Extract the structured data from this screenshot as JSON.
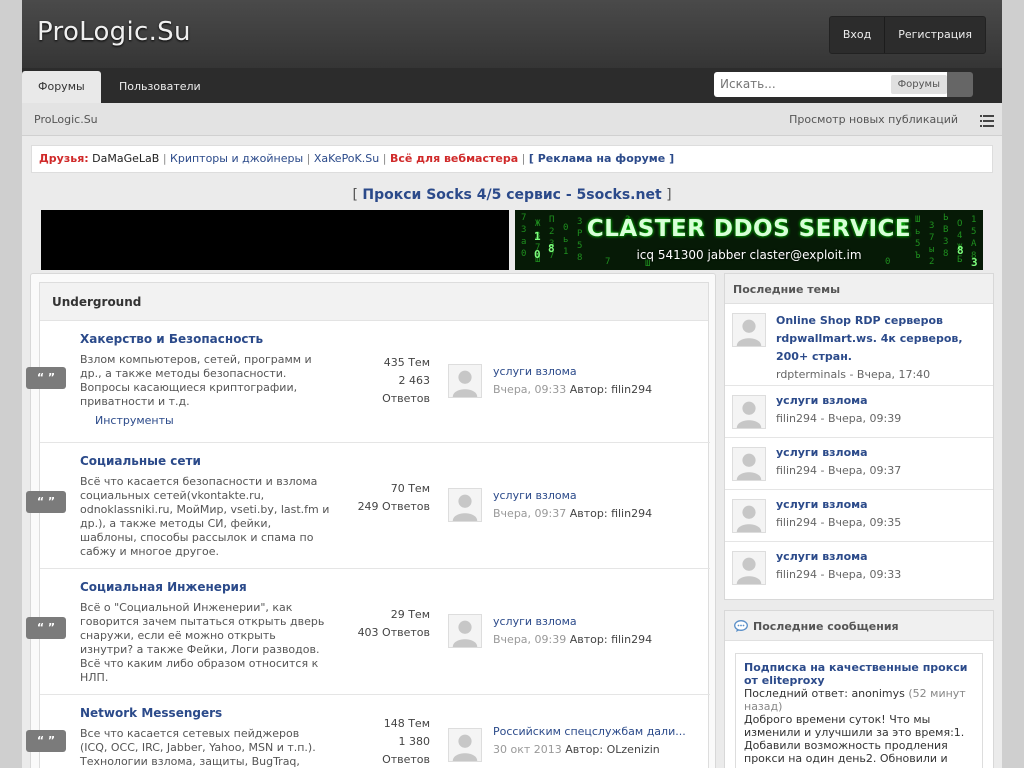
{
  "site": {
    "logo": "ProLogic.Su"
  },
  "userbar": {
    "login": "Вход",
    "register": "Регистрация"
  },
  "nav": {
    "tabs": [
      {
        "label": "Форумы"
      },
      {
        "label": "Пользователи"
      }
    ],
    "search_placeholder": "Искать...",
    "search_scope": "Форумы"
  },
  "breadcrumb": {
    "home": "ProLogic.Su",
    "new_posts": "Просмотр новых публикаций"
  },
  "friends": {
    "label": "Друзья:",
    "links": [
      "DaMaGeLaB",
      "Крипторы и джойнеры",
      "XaKePoK.Su",
      "Всё для вебмастера",
      "[ Реклама на форуме ]"
    ],
    "separator": "|"
  },
  "proxy_ad": {
    "open": "[",
    "link": "Прокси Socks 4/5 сервис - 5socks.net",
    "close": "]"
  },
  "banner": {
    "title": "CLASTER DDOS SERVICE",
    "contacts": "icq 541300    jabber claster@exploit.im"
  },
  "category": {
    "title": "Underground",
    "quote_tag": "“ ”",
    "forums": [
      {
        "title": "Хакерство и Безопасность",
        "desc": "Взлом компьютеров, сетей, программ и др., а также методы безопасности. Вопросы касающиеся криптографии, приватности и т.д.",
        "subforum": "Инструменты",
        "stats": [
          "435 Тем",
          "2 463",
          "Ответов"
        ],
        "last_title": "услуги взлома",
        "last_date": "Вчера, 09:33",
        "last_author": "Автор: filin294"
      },
      {
        "title": "Социальные сети",
        "desc": "Всё что касается безопасности и взлома социальных сетей(vkontakte.ru, odnoklassniki.ru, МойМир, vseti.by, last.fm и др.), а также методы СИ, фейки, шаблоны, способы рассылок и спама по сабжу и многое другое.",
        "stats": [
          "70 Тем",
          "249 Ответов"
        ],
        "last_title": "услуги взлома",
        "last_date": "Вчера, 09:37",
        "last_author": "Автор: filin294"
      },
      {
        "title": "Социальная Инженерия",
        "desc": "Всё о \"Социальной Инженерии\", как говорится зачем пытаться открыть дверь снаружи, если её можно открыть изнутри? а также Фейки, Логи разводов. Всё что каким либо образом относится к НЛП.",
        "stats": [
          "29 Тем",
          "403 Ответов"
        ],
        "last_title": "услуги взлома",
        "last_date": "Вчера, 09:39",
        "last_author": "Автор: filin294"
      },
      {
        "title": "Network Messengers",
        "desc": "Все что касается сетевых пейджеров (ICQ, OCC, IRC, Jabber, Yahoo, MSN и т.п.). Технологии взлома, защиты, BugTraq,",
        "stats": [
          "148 Тем",
          "1 380",
          "Ответов"
        ],
        "last_title": "Российским спецслужбам дали...",
        "last_date": "30 окт 2013",
        "last_author": "Автор: OLzenizin"
      }
    ]
  },
  "recent_topics": {
    "title": "Последние темы",
    "items": [
      {
        "title": "Online Shop RDP серверов rdpwallmart.ws. 4к серверов, 200+ стран.",
        "meta": "rdpterminals - Вчера, 17:40"
      },
      {
        "title": "услуги взлома",
        "meta": "filin294 - Вчера, 09:39"
      },
      {
        "title": "услуги взлома",
        "meta": "filin294 - Вчера, 09:37"
      },
      {
        "title": "услуги взлома",
        "meta": "filin294 - Вчера, 09:35"
      },
      {
        "title": "услуги взлома",
        "meta": "filin294 - Вчера, 09:33"
      }
    ]
  },
  "recent_posts": {
    "title": "Последние сообщения",
    "post_title": "Подписка на качественные прокси от eliteproxy",
    "reply_label": "Последний ответ: anonimys",
    "reply_time": "(52 минут назад)",
    "excerpt": "Доброго времени суток! Что мы изменили и улучшили за это время:1. Добавили возможность продления прокси на один день2. Обновили и"
  },
  "colors": {
    "link": "#2b4a8a",
    "accent_red": "#d02a2a",
    "header_bg": "#3f3f3f"
  },
  "icons": [
    "list-icon",
    "chat-bubble-icon",
    "quote-icon",
    "avatar-placeholder-icon",
    "search-icon"
  ]
}
